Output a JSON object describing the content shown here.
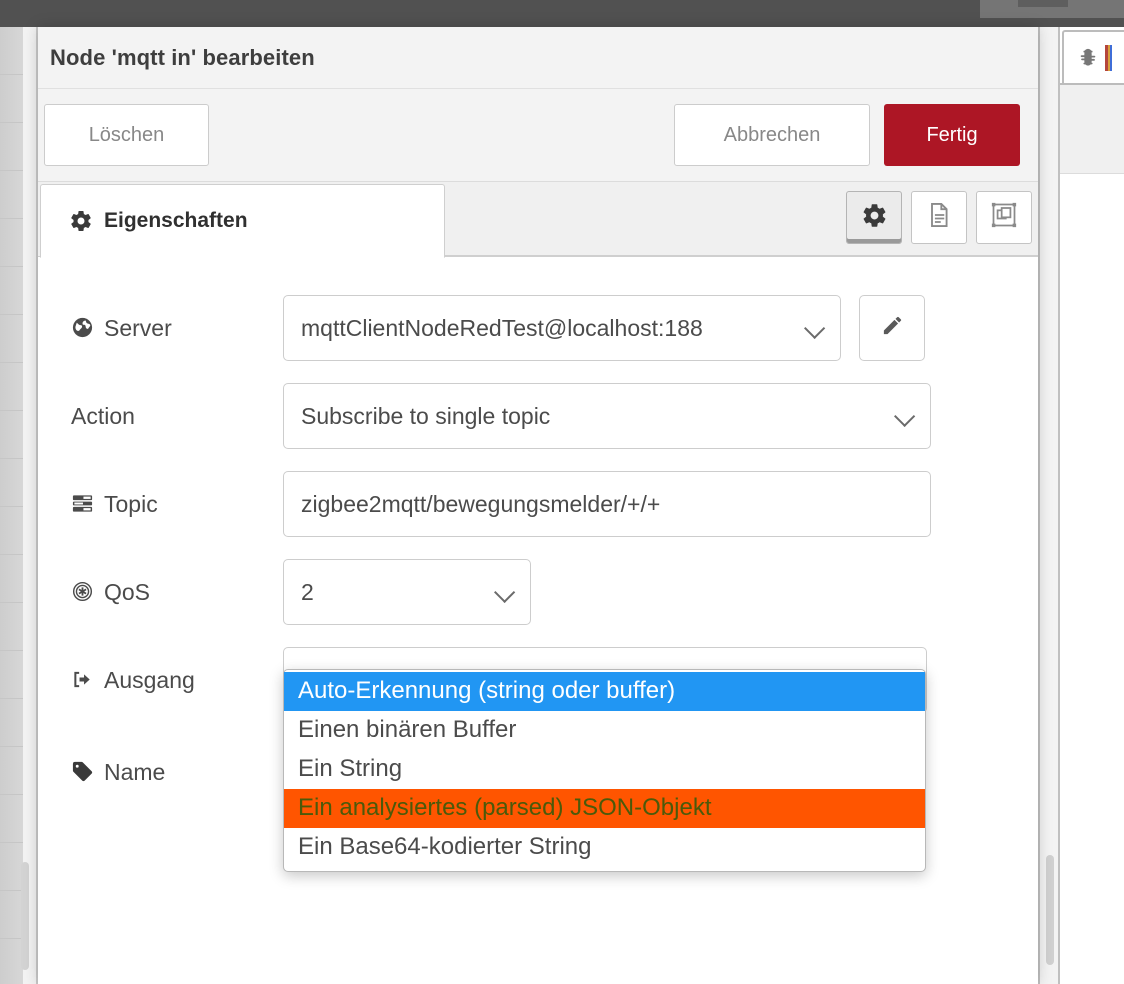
{
  "window": {
    "title": "Node 'mqtt in' bearbeiten"
  },
  "toolbar": {
    "delete_label": "Löschen",
    "cancel_label": "Abbrechen",
    "done_label": "Fertig",
    "done_color": "#ad1625"
  },
  "tabs": {
    "active_label": "Eigenschaften",
    "icon_buttons": [
      {
        "name": "gear-icon",
        "active": true
      },
      {
        "name": "description-icon",
        "active": false
      },
      {
        "name": "appearance-icon",
        "active": false
      }
    ]
  },
  "form": {
    "rows": [
      {
        "id": "server",
        "icon": "globe-icon",
        "label": "Server",
        "value": "mqttClientNodeRedTest@localhost:188",
        "type": "select",
        "has_edit_button": true
      },
      {
        "id": "action",
        "icon": "",
        "label": "Action",
        "value": "Subscribe to single topic",
        "type": "select",
        "has_edit_button": false
      },
      {
        "id": "topic",
        "icon": "list-icon",
        "label": "Topic",
        "value": "zigbee2mqtt/bewegungsmelder/+/+",
        "type": "text",
        "has_edit_button": false
      },
      {
        "id": "qos",
        "icon": "qos-icon",
        "label": "QoS",
        "value": "2",
        "type": "select",
        "has_edit_button": false
      },
      {
        "id": "output",
        "icon": "sign-out-icon",
        "label": "Ausgang",
        "value": "Auto-Erkennung (string oder buffer)",
        "type": "select",
        "has_edit_button": false
      },
      {
        "id": "name",
        "icon": "tag-icon",
        "label": "Name",
        "value": "",
        "type": "text",
        "has_edit_button": false
      }
    ]
  },
  "output_dropdown": {
    "open": true,
    "selected_index": 0,
    "hovered_index": 3,
    "selected_bg": "#2196f3",
    "hover_bg": "#ff5500",
    "options": [
      "Auto-Erkennung (string oder buffer)",
      "Einen binären Buffer",
      "Ein String",
      "Ein analysiertes (parsed) JSON-Objekt",
      "Ein Base64-kodierter String"
    ]
  },
  "debug_panel": {
    "tab_icon": "bug-icon"
  }
}
